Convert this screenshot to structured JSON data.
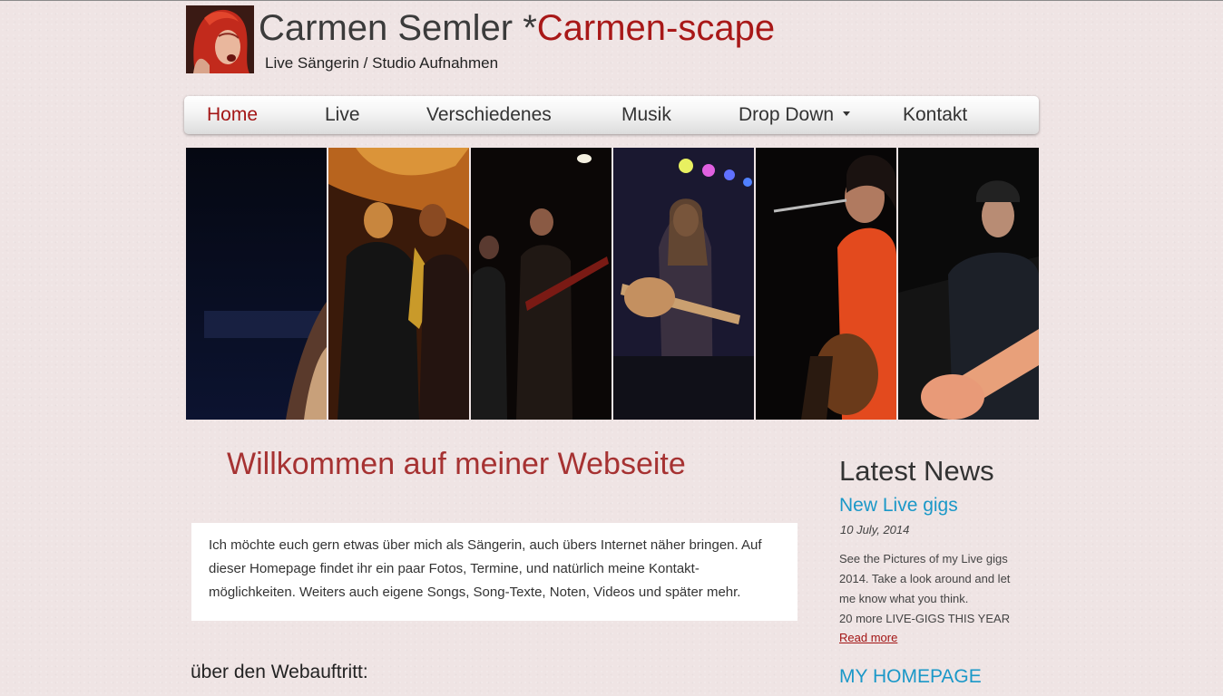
{
  "header": {
    "title_main": "Carmen Semler *",
    "title_accent": "Carmen-scape",
    "tagline": "Live Sängerin / Studio Aufnahmen"
  },
  "nav": {
    "items": [
      {
        "label": "Home",
        "active": true
      },
      {
        "label": "Live"
      },
      {
        "label": "Verschiedenes"
      },
      {
        "label": "Musik"
      },
      {
        "label": "Drop Down",
        "has_dropdown": true
      },
      {
        "label": "Kontakt"
      }
    ]
  },
  "main": {
    "welcome": "Willkommen auf meiner Webseite",
    "intro_lines": [
      "Ich möchte euch gern etwas über mich als Sängerin, auch übers Internet näher bringen. Auf",
      "dieser Homepage findet ihr ein paar Fotos, Termine, und natürlich meine Kontakt-",
      "möglichkeiten. Weiters auch eigene Songs, Song-Texte, Noten, Videos und später mehr."
    ],
    "about_heading": "über den Webauftritt:"
  },
  "sidebar": {
    "title": "Latest News",
    "news": {
      "title": "New Live gigs",
      "date": "10 July, 2014",
      "body_lines": [
        "See the Pictures of my Live gigs",
        "2014. Take a look around and let",
        "me know what you think.",
        "20 more LIVE-GIGS THIS YEAR"
      ],
      "read_more": "Read more"
    },
    "homepage_title": "MY HOMEPAGE"
  },
  "colors": {
    "accent_red": "#a81818",
    "link_blue": "#1b98c8",
    "page_bg": "#efe4e4"
  }
}
